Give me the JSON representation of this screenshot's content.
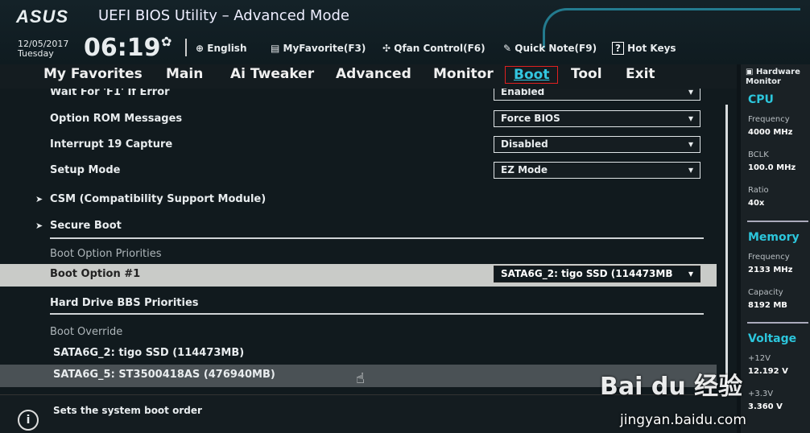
{
  "header": {
    "logo": "ASUS",
    "title": "UEFI BIOS Utility – Advanced Mode",
    "date": "12/05/2017",
    "day": "Tuesday",
    "time": "06:19",
    "toolbar": [
      {
        "icon": "globe-icon",
        "glyph": "⊕",
        "label": "English"
      },
      {
        "icon": "favorite-icon",
        "glyph": "▤",
        "label": "MyFavorite(F3)"
      },
      {
        "icon": "fan-icon",
        "glyph": "✣",
        "label": "Qfan Control(F6)"
      },
      {
        "icon": "note-icon",
        "glyph": "✎",
        "label": "Quick Note(F9)"
      },
      {
        "icon": "help-icon",
        "glyph": "?",
        "label": "Hot Keys"
      }
    ]
  },
  "tabs": [
    "My Favorites",
    "Main",
    "Ai Tweaker",
    "Advanced",
    "Monitor",
    "Boot",
    "Tool",
    "Exit"
  ],
  "active_tab": "Boot",
  "settings": [
    {
      "label": "Wait For 'F1' If Error",
      "value": "Enabled"
    },
    {
      "label": "Option ROM Messages",
      "value": "Force BIOS"
    },
    {
      "label": "Interrupt 19 Capture",
      "value": "Disabled"
    },
    {
      "label": "Setup Mode",
      "value": "EZ Mode"
    }
  ],
  "submenus": [
    "CSM (Compatibility Support Module)",
    "Secure Boot"
  ],
  "boot_priorities": {
    "header": "Boot Option Priorities",
    "option_label": "Boot Option #1",
    "option_value": "SATA6G_2: tigo SSD  (114473MB",
    "bbs": "Hard Drive BBS Priorities"
  },
  "boot_override": {
    "header": "Boot Override",
    "items": [
      "SATA6G_2: tigo SSD  (114473MB)",
      "SATA6G_5: ST3500418AS  (476940MB)"
    ]
  },
  "footer": {
    "help": "Sets the system boot order"
  },
  "sidebar": {
    "title": "Hardware Monitor",
    "cpu": {
      "title": "CPU",
      "frequency_label": "Frequency",
      "frequency": "4000 MHz",
      "bclk_label": "BCLK",
      "bclk": "100.0 MHz",
      "ratio_label": "Ratio",
      "ratio": "40x"
    },
    "memory": {
      "title": "Memory",
      "frequency_label": "Frequency",
      "frequency": "2133 MHz",
      "capacity_label": "Capacity",
      "capacity": "8192 MB"
    },
    "voltage": {
      "title": "Voltage",
      "v12_label": "+12V",
      "v12": "12.192 V",
      "v33_label": "+3.3V",
      "v33": "3.360 V"
    }
  },
  "watermark": {
    "brand": "Bai du 经验",
    "url": "jingyan.baidu.com"
  },
  "colors": {
    "accent": "#2cc6dc",
    "highlight_box": "#e02020"
  }
}
